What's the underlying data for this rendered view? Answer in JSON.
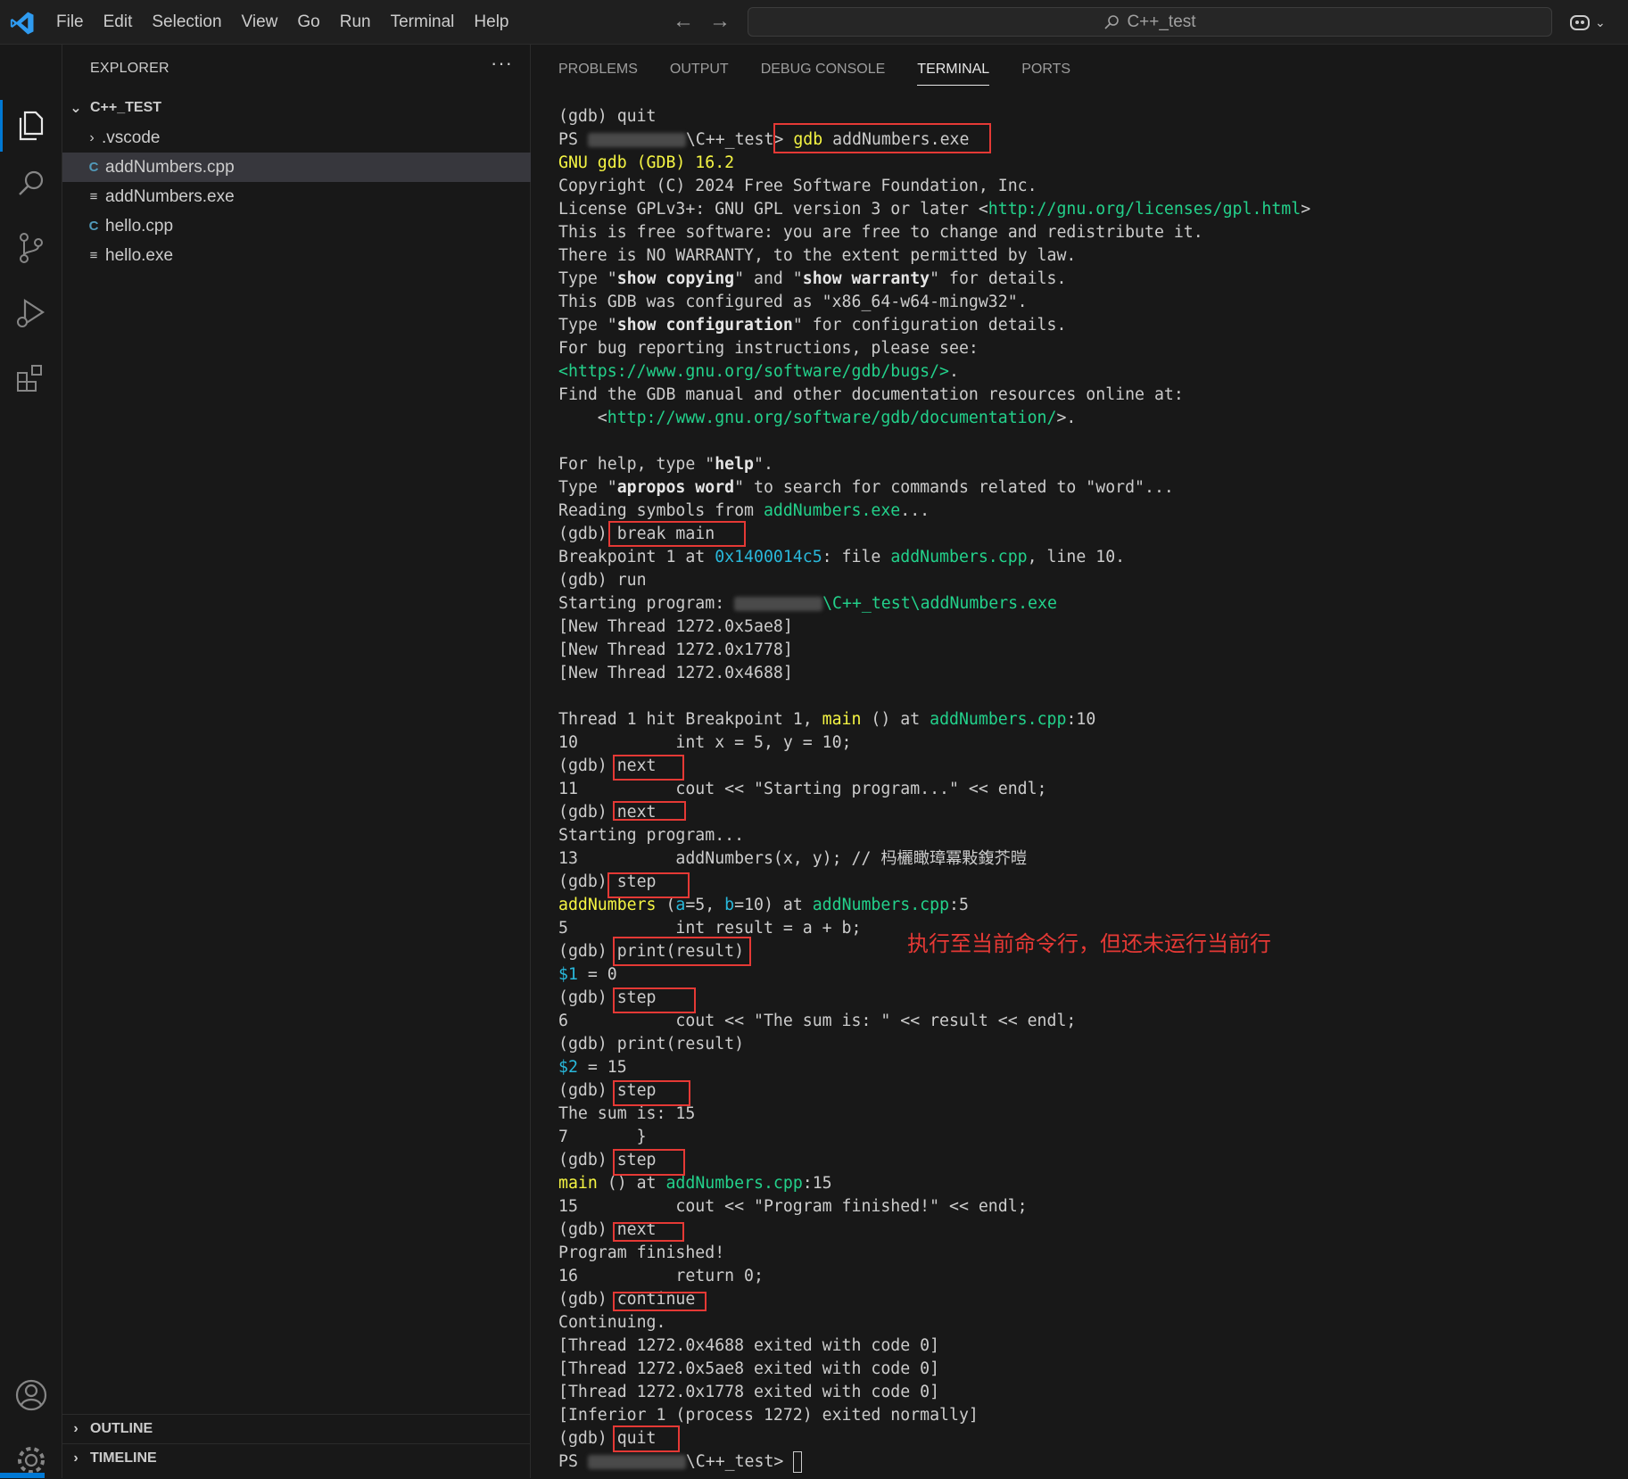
{
  "menu": [
    "File",
    "Edit",
    "Selection",
    "View",
    "Go",
    "Run",
    "Terminal",
    "Help"
  ],
  "search": {
    "text": "C++_test"
  },
  "explorer": {
    "title": "EXPLORER",
    "more": "···",
    "folder": "C++_TEST",
    "items": [
      {
        "label": ".vscode",
        "type": "folder"
      },
      {
        "label": "addNumbers.cpp",
        "type": "cpp",
        "selected": true
      },
      {
        "label": "addNumbers.exe",
        "type": "exe"
      },
      {
        "label": "hello.cpp",
        "type": "cpp"
      },
      {
        "label": "hello.exe",
        "type": "exe"
      }
    ],
    "outline": "OUTLINE",
    "timeline": "TIMELINE"
  },
  "panel_tabs": [
    "PROBLEMS",
    "OUTPUT",
    "DEBUG CONSOLE",
    "TERMINAL",
    "PORTS"
  ],
  "active_tab": "TERMINAL",
  "annotation": "执行至当前命令行，但还未运行当前行",
  "colors": {
    "accent": "#0078d4",
    "terminal_green": "#23d18b",
    "terminal_yellow": "#f5f543",
    "terminal_blue": "#29b8db",
    "highlight_box": "#e53935"
  },
  "terminal_lines": [
    [
      {
        "t": "(gdb) quit"
      }
    ],
    [
      {
        "t": "PS "
      },
      {
        "blur": "xxxxxxxxxx"
      },
      {
        "t": "\\C++_test> "
      },
      {
        "t": "gdb",
        "c": "y"
      },
      {
        "t": " addNumbers.exe"
      }
    ],
    [
      {
        "t": "GNU gdb (GDB) 16.2",
        "c": "y"
      }
    ],
    [
      {
        "t": "Copyright (C) 2024 Free Software Foundation, Inc."
      }
    ],
    [
      {
        "t": "License GPLv3+: GNU GPL version 3 or later <"
      },
      {
        "t": "http://gnu.org/licenses/gpl.html",
        "c": "g"
      },
      {
        "t": ">"
      }
    ],
    [
      {
        "t": "This is free software: you are free to change and redistribute it."
      }
    ],
    [
      {
        "t": "There is NO WARRANTY, to the extent permitted by law."
      }
    ],
    [
      {
        "t": "Type \""
      },
      {
        "t": "show copying",
        "c": "bold"
      },
      {
        "t": "\" and \""
      },
      {
        "t": "show warranty",
        "c": "bold"
      },
      {
        "t": "\" for details."
      }
    ],
    [
      {
        "t": "This GDB was configured as \"x86_64-w64-mingw32\"."
      }
    ],
    [
      {
        "t": "Type \""
      },
      {
        "t": "show configuration",
        "c": "bold"
      },
      {
        "t": "\" for configuration details."
      }
    ],
    [
      {
        "t": "For bug reporting instructions, please see:"
      }
    ],
    [
      {
        "t": "<https://www.gnu.org/software/gdb/bugs/>",
        "c": "g"
      },
      {
        "t": "."
      }
    ],
    [
      {
        "t": "Find the GDB manual and other documentation resources online at:"
      }
    ],
    [
      {
        "t": "    <"
      },
      {
        "t": "http://www.gnu.org/software/gdb/documentation/",
        "c": "g"
      },
      {
        "t": ">."
      }
    ],
    [
      {
        "t": ""
      }
    ],
    [
      {
        "t": "For help, type \""
      },
      {
        "t": "help",
        "c": "bold"
      },
      {
        "t": "\"."
      }
    ],
    [
      {
        "t": "Type \""
      },
      {
        "t": "apropos word",
        "c": "bold"
      },
      {
        "t": "\" to search for commands related to \"word\"..."
      }
    ],
    [
      {
        "t": "Reading symbols from "
      },
      {
        "t": "addNumbers.exe",
        "c": "g"
      },
      {
        "t": "..."
      }
    ],
    [
      {
        "t": "(gdb) break main"
      }
    ],
    [
      {
        "t": "Breakpoint 1 at "
      },
      {
        "t": "0x1400014c5",
        "c": "b"
      },
      {
        "t": ": file "
      },
      {
        "t": "addNumbers.cpp",
        "c": "g"
      },
      {
        "t": ", line 10."
      }
    ],
    [
      {
        "t": "(gdb) run"
      }
    ],
    [
      {
        "t": "Starting program: "
      },
      {
        "blur": "xxxxxxxxx",
        "c": "g"
      },
      {
        "t": "\\C++_test\\addNumbers.exe",
        "c": "g"
      }
    ],
    [
      {
        "t": "[New Thread 1272.0x5ae8]"
      }
    ],
    [
      {
        "t": "[New Thread 1272.0x1778]"
      }
    ],
    [
      {
        "t": "[New Thread 1272.0x4688]"
      }
    ],
    [
      {
        "t": ""
      }
    ],
    [
      {
        "t": "Thread 1 hit Breakpoint 1, "
      },
      {
        "t": "main",
        "c": "y"
      },
      {
        "t": " () at "
      },
      {
        "t": "addNumbers.cpp",
        "c": "g"
      },
      {
        "t": ":10"
      }
    ],
    [
      {
        "t": "10          int x = 5, y = 10;"
      }
    ],
    [
      {
        "t": "(gdb) next"
      }
    ],
    [
      {
        "t": "11          cout << \"Starting program...\" << endl;"
      }
    ],
    [
      {
        "t": "(gdb) next"
      }
    ],
    [
      {
        "t": "Starting program..."
      }
    ],
    [
      {
        "t": "13          addNumbers(x, y); // 杩欐瞰璋冪敤鍑芥暟"
      }
    ],
    [
      {
        "t": "(gdb) step"
      }
    ],
    [
      {
        "t": "addNumbers",
        "c": "y"
      },
      {
        "t": " ("
      },
      {
        "t": "a",
        "c": "b"
      },
      {
        "t": "=5, "
      },
      {
        "t": "b",
        "c": "b"
      },
      {
        "t": "=10) at "
      },
      {
        "t": "addNumbers.cpp",
        "c": "g"
      },
      {
        "t": ":5"
      }
    ],
    [
      {
        "t": "5           int result = a + b;"
      }
    ],
    [
      {
        "t": "(gdb) print(result)"
      }
    ],
    [
      {
        "t": "$1",
        "c": "b"
      },
      {
        "t": " = 0"
      }
    ],
    [
      {
        "t": "(gdb) step"
      }
    ],
    [
      {
        "t": "6           cout << \"The sum is: \" << result << endl;"
      }
    ],
    [
      {
        "t": "(gdb) print(result)"
      }
    ],
    [
      {
        "t": "$2",
        "c": "b"
      },
      {
        "t": " = 15"
      }
    ],
    [
      {
        "t": "(gdb) step"
      }
    ],
    [
      {
        "t": "The sum is: 15"
      }
    ],
    [
      {
        "t": "7       }"
      }
    ],
    [
      {
        "t": "(gdb) step"
      }
    ],
    [
      {
        "t": "main",
        "c": "y"
      },
      {
        "t": " () at "
      },
      {
        "t": "addNumbers.cpp",
        "c": "g"
      },
      {
        "t": ":15"
      }
    ],
    [
      {
        "t": "15          cout << \"Program finished!\" << endl;"
      }
    ],
    [
      {
        "t": "(gdb) next"
      }
    ],
    [
      {
        "t": "Program finished!"
      }
    ],
    [
      {
        "t": "16          return 0;"
      }
    ],
    [
      {
        "t": "(gdb) continue"
      }
    ],
    [
      {
        "t": "Continuing."
      }
    ],
    [
      {
        "t": "[Thread 1272.0x4688 exited with code 0]"
      }
    ],
    [
      {
        "t": "[Thread 1272.0x5ae8 exited with code 0]"
      }
    ],
    [
      {
        "t": "[Thread 1272.0x1778 exited with code 0]"
      }
    ],
    [
      {
        "t": "[Inferior 1 (process 1272) exited normally]"
      }
    ],
    [
      {
        "t": "(gdb) quit"
      }
    ],
    [
      {
        "t": "PS "
      },
      {
        "blur": "xxxxxxxxxx"
      },
      {
        "t": "\\C++_test> "
      },
      {
        "cursor": true
      }
    ]
  ]
}
